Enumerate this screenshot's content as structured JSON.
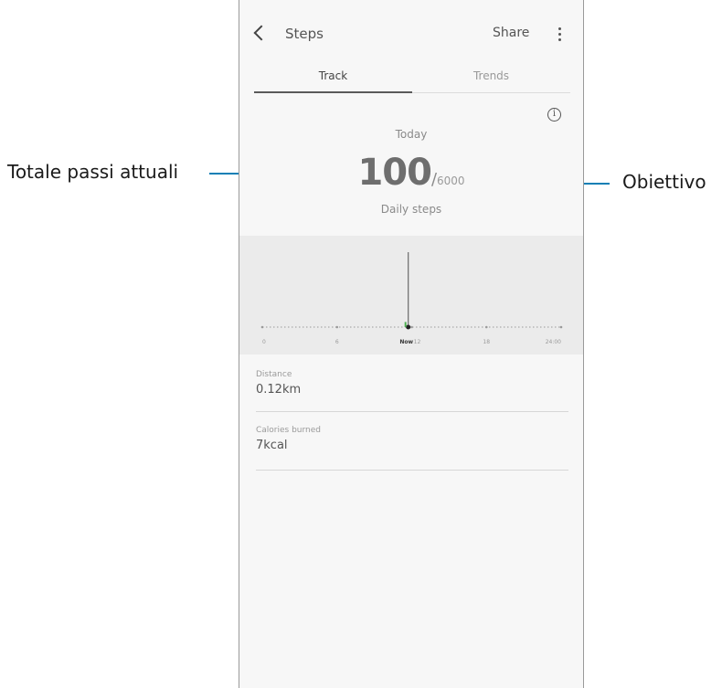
{
  "annotations": {
    "left_label": "Totale passi attuali",
    "right_label": "Obiettivo"
  },
  "header": {
    "title": "Steps",
    "share": "Share"
  },
  "tabs": [
    {
      "label": "Track",
      "selected": true
    },
    {
      "label": "Trends",
      "selected": false
    }
  ],
  "summary": {
    "period": "Today",
    "steps": "100",
    "separator": "/",
    "target": "6000",
    "caption": "Daily steps"
  },
  "chart_data": {
    "type": "bar",
    "x_ticks": [
      "0",
      "6",
      "Now",
      "12",
      "18",
      "24:00"
    ],
    "bars": [
      {
        "hour": 11.5,
        "value": 100
      }
    ],
    "accent": "#4caf50"
  },
  "stats": [
    {
      "label": "Distance",
      "value": "0.12km"
    },
    {
      "label": "Calories burned",
      "value": "7kcal"
    }
  ],
  "colors": {
    "annotation_line": "#0f7fb5",
    "background": "#f7f7f7",
    "chart_bg": "#ebebeb"
  }
}
